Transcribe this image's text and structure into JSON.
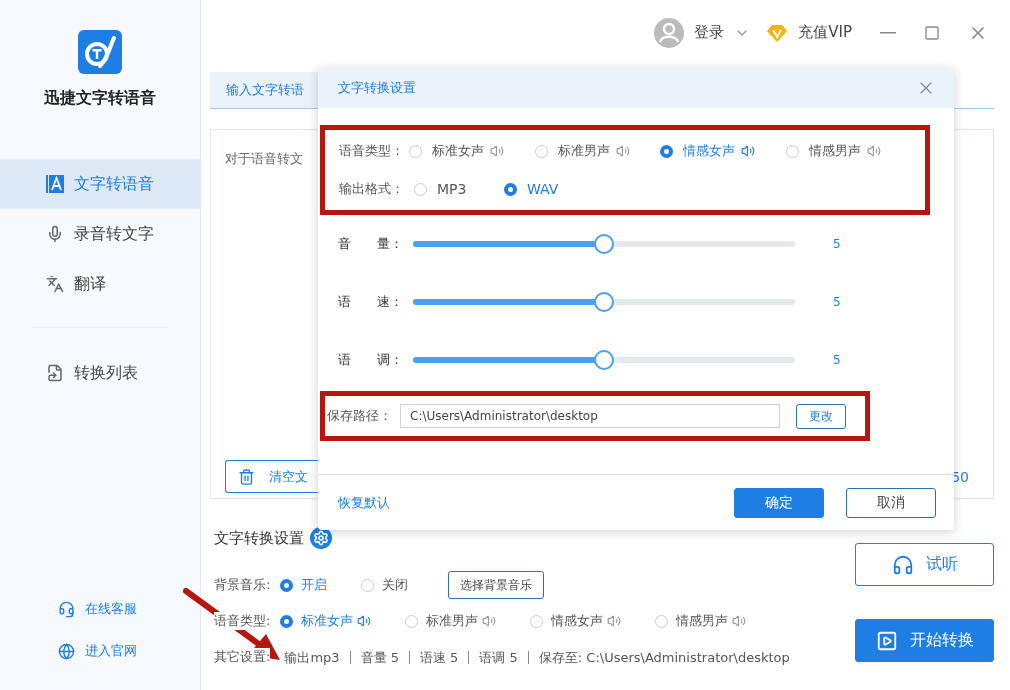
{
  "app": {
    "name": "迅捷文字转语音"
  },
  "header": {
    "login": "登录",
    "vip": "充值VIP"
  },
  "sidebar": {
    "items": [
      {
        "kind": "text",
        "label": "文字转语音",
        "selected": true
      },
      {
        "kind": "mic",
        "label": "录音转文字",
        "selected": false
      },
      {
        "kind": "translate",
        "label": "翻译",
        "selected": false
      }
    ],
    "list_item": {
      "label": "转换列表",
      "selected": false
    },
    "links": [
      {
        "kind": "support",
        "label": "在线客服"
      },
      {
        "kind": "web",
        "label": "进入官网"
      }
    ]
  },
  "editor": {
    "tab": {
      "label": "输入文字转语",
      "selected": true
    },
    "text": "对于语音转文",
    "clear_button": "清空文",
    "counter": "50"
  },
  "dialog": {
    "title": "文字转换设置",
    "voice_label": "语音类型：",
    "voices": [
      {
        "label": "标准女声",
        "selected": false
      },
      {
        "label": "标准男声",
        "selected": false
      },
      {
        "label": "情感女声",
        "selected": true
      },
      {
        "label": "情感男声",
        "selected": false
      }
    ],
    "format_label": "输出格式：",
    "formats": [
      {
        "label": "MP3",
        "selected": false
      },
      {
        "label": "WAV",
        "selected": true
      }
    ],
    "sliders": [
      {
        "label": "音　　量：",
        "level": 0.5,
        "reading": "5"
      },
      {
        "label": "语　　速：",
        "level": 0.5,
        "reading": "5"
      },
      {
        "label": "语　　调：",
        "level": 0.5,
        "reading": "5"
      }
    ],
    "path_label": "保存路径：",
    "path": "C:\\Users\\Administrator\\desktop",
    "change_button": "更改",
    "reset_link": "恢复默认",
    "ok_button": "确定",
    "cancel_button": "取消"
  },
  "settings": {
    "title": "文字转换设置",
    "music_label": "背景音乐:",
    "music": [
      {
        "label": "开启",
        "selected": true
      },
      {
        "label": "关闭",
        "selected": false
      }
    ],
    "music_button": "选择背景音乐",
    "voice_label": "语音类型:",
    "voices": [
      {
        "label": "标准女声",
        "selected": true
      },
      {
        "label": "标准男声",
        "selected": false
      },
      {
        "label": "情感女声",
        "selected": false
      },
      {
        "label": "情感男声",
        "selected": false
      }
    ],
    "other_label": "其它设置:",
    "other": [
      "输出mp3",
      "音量 5",
      "语速 5",
      "语调 5",
      "保存至: C:\\Users\\Administrator\\desktop"
    ],
    "preview_button": "试听",
    "start_button": "开始转换"
  }
}
